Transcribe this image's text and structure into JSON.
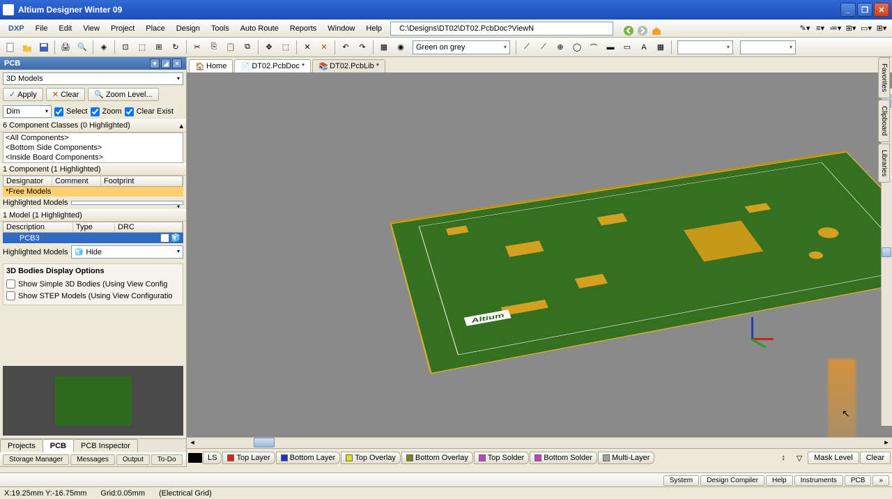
{
  "title": "Altium Designer Winter 09",
  "menu": [
    "DXP",
    "File",
    "Edit",
    "View",
    "Project",
    "Place",
    "Design",
    "Tools",
    "Auto Route",
    "Reports",
    "Window",
    "Help"
  ],
  "address": "C:\\Designs\\DT02\\DT02.PcbDoc?ViewN",
  "color_theme": "Green on grey",
  "panel": {
    "title": "PCB",
    "mode": "3D Models",
    "apply": "Apply",
    "clear": "Clear",
    "zoom": "Zoom Level...",
    "dim": "Dim",
    "opts": [
      "Select",
      "Zoom",
      "Clear Exist"
    ],
    "classes_hdr": "6 Component Classes (0 Highlighted)",
    "classes": [
      "<All Components>",
      "<Bottom Side Components>",
      "<Inside Board Components>"
    ],
    "comp_hdr": "1 Component (1 Highlighted)",
    "comp_cols": [
      "Designator",
      "Comment",
      "Footprint"
    ],
    "comp_row": "*Free Models",
    "hl_models": "Highlighted Models",
    "model_hdr": "1 Model (1 Highlighted)",
    "model_cols": [
      "Description",
      "Type",
      "DRC"
    ],
    "model_row": "PCB3",
    "hide": "Hide",
    "group_title": "3D Bodies Display Options",
    "opt1": "Show Simple 3D Bodies (Using View Config",
    "opt2": "Show STEP Models (Using View Configuratio"
  },
  "side_tabs": [
    "Projects",
    "PCB",
    "PCB Inspector"
  ],
  "side_tabs2": [
    "Storage Manager",
    "Messages",
    "Output",
    "To-Do"
  ],
  "doc_tabs": [
    {
      "label": "Home",
      "icon": "home"
    },
    {
      "label": "DT02.PcbDoc *",
      "icon": "pcb"
    },
    {
      "label": "DT02.PcbLib *",
      "icon": "lib"
    }
  ],
  "layers": [
    {
      "name": "LS",
      "color": "#404040"
    },
    {
      "name": "Top Layer",
      "color": "#e02020"
    },
    {
      "name": "Bottom Layer",
      "color": "#2030c0"
    },
    {
      "name": "Top Overlay",
      "color": "#e0e020"
    },
    {
      "name": "Bottom Overlay",
      "color": "#808020"
    },
    {
      "name": "Top Solder",
      "color": "#c040c0"
    },
    {
      "name": "Bottom Solder",
      "color": "#c040c0"
    },
    {
      "name": "Multi-Layer",
      "color": "#a0a0a0"
    }
  ],
  "layer_btns": [
    "Mask Level",
    "Clear"
  ],
  "right_tabs": [
    "Favorites",
    "Clipboard",
    "Libraries"
  ],
  "footer_btns": [
    "System",
    "Design Compiler",
    "Help",
    "Instruments",
    "PCB"
  ],
  "status": {
    "coords": "X:19.25mm Y:-16.75mm",
    "grid": "Grid:0.05mm",
    "mode": "(Electrical Grid)"
  }
}
